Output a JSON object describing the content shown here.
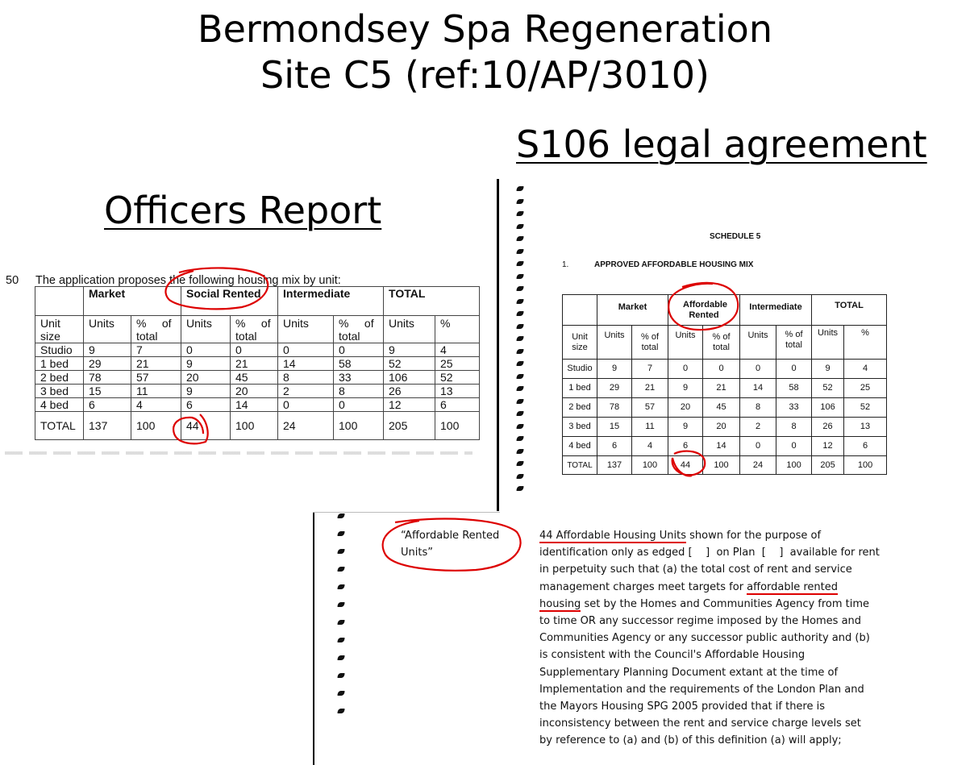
{
  "title": {
    "line1": "Bermondsey Spa Regeneration",
    "line2": "Site C5 (ref:10/AP/3010)"
  },
  "s106": {
    "heading": "S106 legal agreement",
    "schedule": "SCHEDULE 5",
    "item_number": "1.",
    "item_title": "APPROVED AFFORDABLE HOUSING MIX",
    "table": {
      "groups": [
        "Market",
        "Affordable Rented",
        "Intermediate",
        "TOTAL"
      ],
      "subheaders": [
        "Unit size",
        "Units",
        "% of total",
        "Units",
        "% of total",
        "Units",
        "% of total",
        "Units",
        "%"
      ],
      "rows": [
        [
          "Studio",
          "9",
          "7",
          "0",
          "0",
          "0",
          "0",
          "9",
          "4"
        ],
        [
          "1 bed",
          "29",
          "21",
          "9",
          "21",
          "14",
          "58",
          "52",
          "25"
        ],
        [
          "2 bed",
          "78",
          "57",
          "20",
          "45",
          "8",
          "33",
          "106",
          "52"
        ],
        [
          "3 bed",
          "15",
          "11",
          "9",
          "20",
          "2",
          "8",
          "26",
          "13"
        ],
        [
          "4 bed",
          "6",
          "4",
          "6",
          "14",
          "0",
          "0",
          "12",
          "6"
        ],
        [
          "TOTAL",
          "137",
          "100",
          "44",
          "100",
          "24",
          "100",
          "205",
          "100"
        ]
      ]
    },
    "definition": {
      "term": "“Affordable Rented Units”",
      "lines": [
        "44 Affordable Housing Units shown for the purpose of",
        "identification only as edged [    ]  on Plan  [    ]  available for rent",
        "in perpetuity such that (a) the total cost of rent and service",
        "management charges meet targets for affordable rented",
        "housing set by the Homes and Communities Agency from time",
        "to time OR any successor regime imposed by the Homes and",
        "Communities Agency or any successor public authority and (b)",
        "is consistent with the Council's Affordable Housing",
        "Supplementary Planning Document extant at the time of",
        "Implementation and the requirements of the London Plan and",
        "the Mayors Housing SPG 2005 provided that if there is",
        "inconsistency between the rent and service charge levels set",
        "by reference to (a) and (b) of this definition (a) will apply;"
      ]
    }
  },
  "officers": {
    "heading": "Officers Report",
    "para_number": "50",
    "intro": "The application proposes the following housing mix by unit:",
    "table": {
      "groups": [
        "Market",
        "Social Rented",
        "Intermediate",
        "TOTAL"
      ],
      "subheaders": [
        "Unit size",
        "Units",
        "%     of total",
        "Units",
        "%     of total",
        "Units",
        "%     of total",
        "Units",
        "%"
      ],
      "rows": [
        [
          "Studio",
          "9",
          "7",
          "0",
          "0",
          "0",
          "0",
          "9",
          "4"
        ],
        [
          "1 bed",
          "29",
          "21",
          "9",
          "21",
          "14",
          "58",
          "52",
          "25"
        ],
        [
          "2 bed",
          "78",
          "57",
          "20",
          "45",
          "8",
          "33",
          "106",
          "52"
        ],
        [
          "3 bed",
          "15",
          "11",
          "9",
          "20",
          "2",
          "8",
          "26",
          "13"
        ],
        [
          "4 bed",
          "6",
          "4",
          "6",
          "14",
          "0",
          "0",
          "12",
          "6"
        ],
        [
          "TOTAL",
          "137",
          "100",
          "44",
          "100",
          "24",
          "100",
          "205",
          "100"
        ]
      ]
    }
  },
  "annotation_color": "#dd0000"
}
